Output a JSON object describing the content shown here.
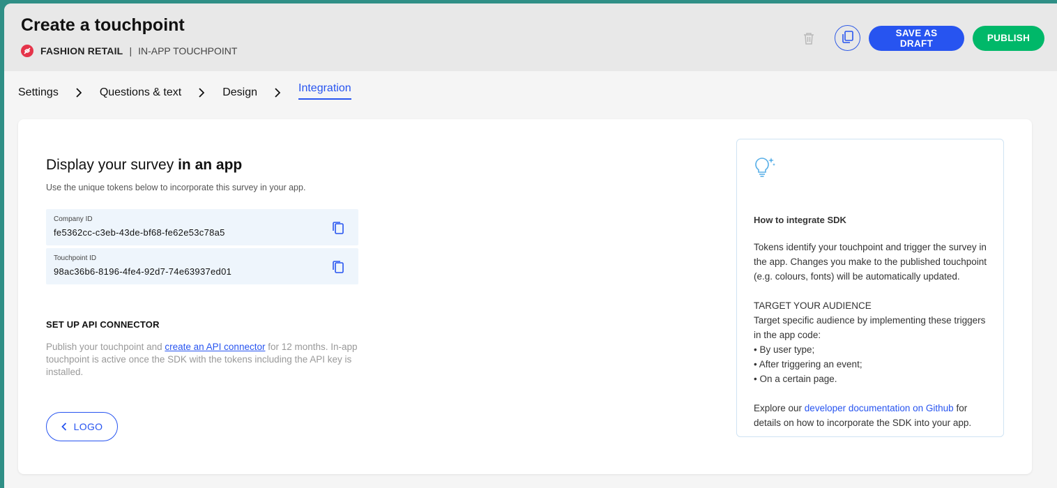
{
  "header": {
    "title": "Create a touchpoint",
    "brand": "FASHION RETAIL",
    "separator": "|",
    "channel": "IN-APP TOUCHPOINT",
    "save_draft_label": "SAVE AS DRAFT",
    "publish_label": "PUBLISH"
  },
  "steps": [
    {
      "label": "Settings"
    },
    {
      "label": "Questions & text"
    },
    {
      "label": "Design"
    },
    {
      "label": "Integration",
      "active": true
    }
  ],
  "main": {
    "title_regular": "Display your survey",
    "title_bold": "in an app",
    "description": "Use the unique tokens below to incorporate this survey in your app.",
    "tokens": [
      {
        "label": "Company ID",
        "value": "fe5362cc-c3eb-43de-bf68-fe62e53c78a5"
      },
      {
        "label": "Touchpoint ID",
        "value": "98ac36b6-8196-4fe4-92d7-74e63937ed01"
      }
    ],
    "api": {
      "title": "SET UP API CONNECTOR",
      "text_before": "Publish your touchpoint and ",
      "link_text": "create an API connector",
      "text_after": " for 12 months. In-app touchpoint is active once the SDK with the tokens including the API key is installed."
    },
    "back_label": "LOGO"
  },
  "tip": {
    "title": "How to integrate SDK",
    "para1": "Tokens identify your touchpoint and trigger the survey in the app. Changes you make to the published touchpoint (e.g. colours, fonts) will be automatically updated.",
    "audience_title": "TARGET YOUR AUDIENCE",
    "audience_text": "Target specific audience by implementing these triggers in the app code:",
    "bullets": [
      "• By user type;",
      "• After triggering an event;",
      "• On a certain page."
    ],
    "explore_before": "Explore our ",
    "explore_link": "developer documentation on Github",
    "explore_after": " for details on how to incorporate the SDK into your app."
  },
  "colors": {
    "accent": "#2754f0",
    "publish": "#00b869",
    "brand_icon": "#e5344a",
    "token_bg": "#eef5fc"
  },
  "icons": [
    "brand-icon",
    "trash-icon",
    "duplicate-icon",
    "chevron-right-icon",
    "copy-icon",
    "chevron-left-icon",
    "lightbulb-icon"
  ]
}
